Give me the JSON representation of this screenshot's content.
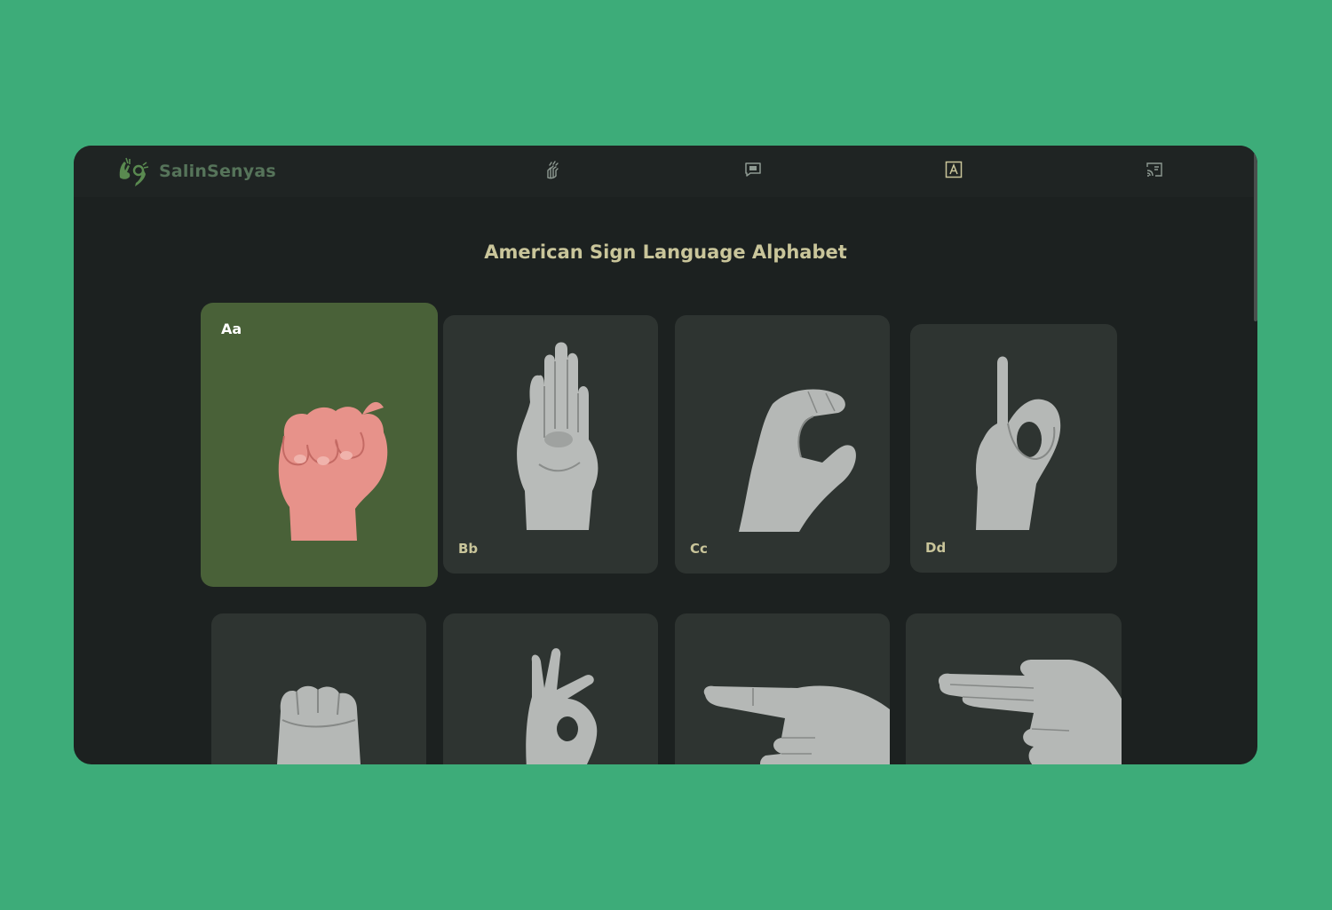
{
  "app": {
    "name": "SalinSenyas"
  },
  "nav": {
    "items": [
      {
        "icon": "sign-hand-icon"
      },
      {
        "icon": "chat-icon"
      },
      {
        "icon": "alphabet-icon"
      },
      {
        "icon": "cast-icon"
      }
    ]
  },
  "page": {
    "title": "American Sign Language Alphabet"
  },
  "cards": [
    {
      "label": "Aa",
      "selected": true
    },
    {
      "label": "Bb",
      "selected": false
    },
    {
      "label": "Cc",
      "selected": false
    },
    {
      "label": "Dd",
      "selected": false
    },
    {
      "label": "",
      "selected": false
    },
    {
      "label": "",
      "selected": false
    },
    {
      "label": "",
      "selected": false
    },
    {
      "label": "",
      "selected": false
    }
  ],
  "colors": {
    "background": "#3dac79",
    "window": "#1c2120",
    "card": "#2e3431",
    "card_active": "#496138",
    "title": "#c9c59a",
    "brand": "#56745a"
  }
}
